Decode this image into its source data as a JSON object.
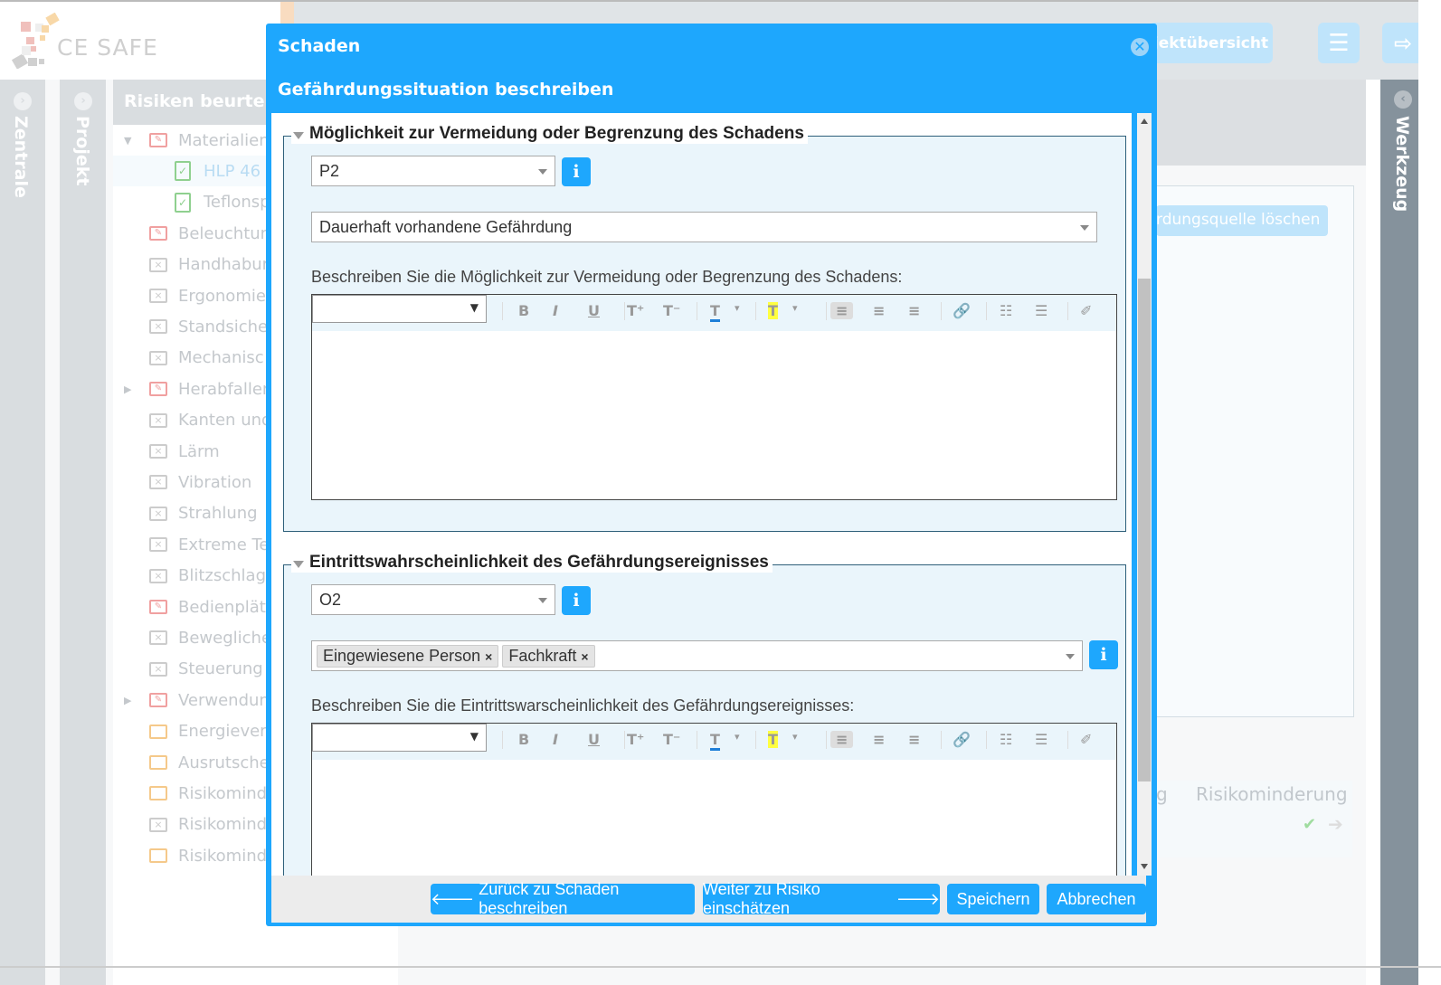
{
  "app": {
    "logo_text": "CE SAFE",
    "nav_button": "Projektübersicht",
    "nav_button_visible": "jektübersicht",
    "menu_icon": "hamburger-icon",
    "logout_icon": "logout-icon"
  },
  "sidebars": {
    "left1": "Zentrale",
    "left2": "Projekt",
    "right": "Werkzeug"
  },
  "tree": {
    "title": "Risiken beurteilen",
    "title_visible": "Risiken beurteile",
    "items": [
      {
        "label": "Materialien",
        "icon": "folder-edit",
        "color": "#f0a0a0",
        "level": 0,
        "expanded": true
      },
      {
        "label": "HLP 46",
        "icon": "doc-check",
        "color": "#8fd08f",
        "level": 1,
        "selected": true
      },
      {
        "label": "Teflonsp",
        "icon": "doc-check",
        "color": "#8fd08f",
        "level": 1
      },
      {
        "label": "Beleuchtun",
        "icon": "folder-edit",
        "color": "#f0a0a0",
        "level": 0
      },
      {
        "label": "Handhabur",
        "icon": "folder-x",
        "color": "#ccc",
        "level": 0
      },
      {
        "label": "Ergonomie",
        "icon": "folder-x",
        "color": "#ccc",
        "level": 0
      },
      {
        "label": "Standsiche",
        "icon": "folder-x",
        "color": "#ccc",
        "level": 0
      },
      {
        "label": "Mechanisc",
        "icon": "folder-x",
        "color": "#ccc",
        "level": 0
      },
      {
        "label": "Herabfallen",
        "icon": "folder-edit",
        "color": "#f0a0a0",
        "level": 0,
        "collapsed": true
      },
      {
        "label": "Kanten und",
        "icon": "folder-x",
        "color": "#ccc",
        "level": 0
      },
      {
        "label": "Lärm",
        "icon": "folder-x",
        "color": "#ccc",
        "level": 0
      },
      {
        "label": "Vibration",
        "icon": "folder-x",
        "color": "#ccc",
        "level": 0
      },
      {
        "label": "Strahlung",
        "icon": "folder-x",
        "color": "#ccc",
        "level": 0
      },
      {
        "label": "Extreme Te",
        "icon": "folder-x",
        "color": "#ccc",
        "level": 0
      },
      {
        "label": "Blitzschlag",
        "icon": "folder-x",
        "color": "#ccc",
        "level": 0
      },
      {
        "label": "Bedienplät",
        "icon": "folder-edit",
        "color": "#f0a0a0",
        "level": 0
      },
      {
        "label": "Bewegliche",
        "icon": "folder-x",
        "color": "#ccc",
        "level": 0
      },
      {
        "label": "Steuerung",
        "icon": "folder-x",
        "color": "#ccc",
        "level": 0
      },
      {
        "label": "Verwendun",
        "icon": "folder-edit",
        "color": "#f0a0a0",
        "level": 0,
        "collapsed": true
      },
      {
        "label": "Energiever",
        "icon": "folder",
        "color": "#f5c98a",
        "level": 0
      },
      {
        "label": "Ausrutsche",
        "icon": "folder",
        "color": "#f5c98a",
        "level": 0
      },
      {
        "label": "Risikomind",
        "icon": "folder",
        "color": "#f5c98a",
        "level": 0
      },
      {
        "label": "Risikomind",
        "icon": "folder-x",
        "color": "#ccc",
        "level": 0
      },
      {
        "label": "Risikomind",
        "icon": "folder",
        "color": "#f5c98a",
        "level": 0
      }
    ]
  },
  "background": {
    "delete_button": "rdungsquelle löschen",
    "step_label": "Risikominderung",
    "step_partial": "g"
  },
  "modal": {
    "title": "Schaden",
    "subtitle": "Gefährdungssituation beschreiben",
    "section1": {
      "legend": "Möglichkeit zur Vermeidung oder Begrenzung des Schadens",
      "select_value": "P2",
      "select2_value": "Dauerhaft vorhandene Gefährdung",
      "desc_label": "Beschreiben Sie die Möglichkeit zur Vermeidung oder Begrenzung des Schadens:",
      "editor_value": ""
    },
    "section2": {
      "legend": "Eintrittswahrscheinlichkeit des Gefährdungsereignisses",
      "select_value": "O2",
      "tags": [
        "Eingewiesene Person",
        "Fachkraft"
      ],
      "desc_label": "Beschreiben Sie die Eintrittswarscheinlichkeit des Gefährdungsereignisses:",
      "editor_value": ""
    },
    "buttons": {
      "back": "Zurück zu Schaden beschreiben",
      "next": "Weiter zu Risiko einschätzen",
      "save": "Speichern",
      "cancel": "Abbrechen"
    }
  },
  "colors": {
    "accent": "#1ea7fd",
    "toolbar_bg": "#eaf5fb"
  }
}
